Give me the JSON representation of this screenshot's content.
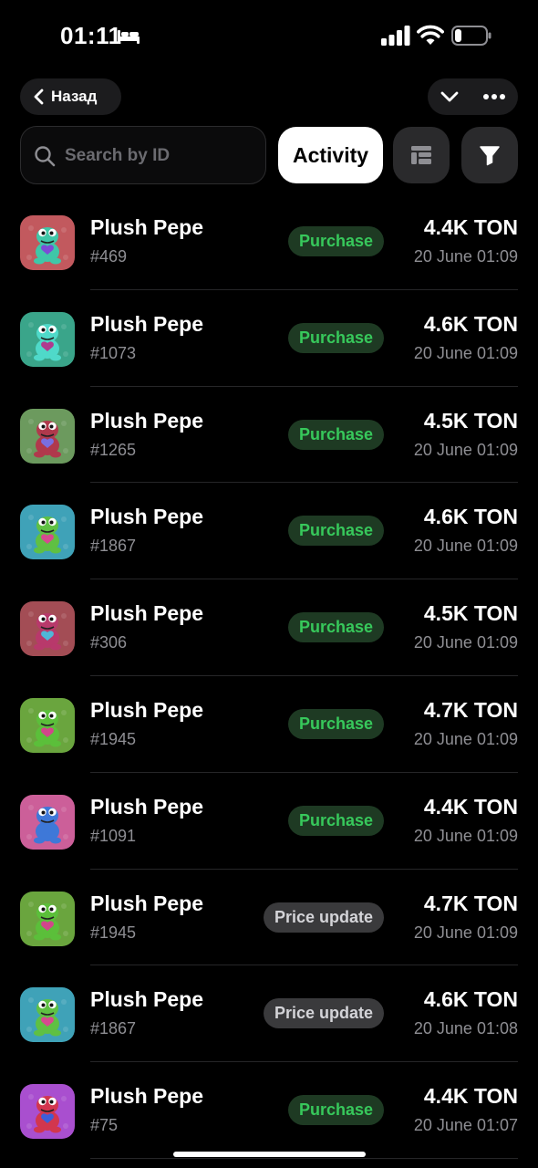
{
  "status": {
    "time": "01:11"
  },
  "nav": {
    "back_label": "Назад"
  },
  "search": {
    "placeholder": "Search by ID"
  },
  "tabs": {
    "active_label": "Activity"
  },
  "colors": {
    "purchase": "#37c85b",
    "background": "#000000"
  },
  "items": [
    {
      "name": "Plush Pepe",
      "id": "#469",
      "action": "Purchase",
      "price": "4.4K TON",
      "date": "20 June 01:09",
      "bg": "#c2595e",
      "frog": "#3fc7a8",
      "accent": "#7c4bd6"
    },
    {
      "name": "Plush Pepe",
      "id": "#1073",
      "action": "Purchase",
      "price": "4.6K TON",
      "date": "20 June 01:09",
      "bg": "#3aa58a",
      "frog": "#4fd9c9",
      "accent": "#b03a8e"
    },
    {
      "name": "Plush Pepe",
      "id": "#1265",
      "action": "Purchase",
      "price": "4.5K TON",
      "date": "20 June 01:09",
      "bg": "#6c9a5e",
      "frog": "#b0394c",
      "accent": "#7a6ee0"
    },
    {
      "name": "Plush Pepe",
      "id": "#1867",
      "action": "Purchase",
      "price": "4.6K TON",
      "date": "20 June 01:09",
      "bg": "#3fa2b8",
      "frog": "#5fc043",
      "accent": "#d64a8f"
    },
    {
      "name": "Plush Pepe",
      "id": "#306",
      "action": "Purchase",
      "price": "4.5K TON",
      "date": "20 June 01:09",
      "bg": "#a34d55",
      "frog": "#b8396b",
      "accent": "#4fb7d8"
    },
    {
      "name": "Plush Pepe",
      "id": "#1945",
      "action": "Purchase",
      "price": "4.7K TON",
      "date": "20 June 01:09",
      "bg": "#6aa53e",
      "frog": "#5bbf3a",
      "accent": "#d2468b"
    },
    {
      "name": "Plush Pepe",
      "id": "#1091",
      "action": "Purchase",
      "price": "4.4K TON",
      "date": "20 June 01:09",
      "bg": "#cc5f99",
      "frog": "#3e78d8",
      "accent": "#3e78d8"
    },
    {
      "name": "Plush Pepe",
      "id": "#1945",
      "action": "Price update",
      "price": "4.7K TON",
      "date": "20 June 01:09",
      "bg": "#6aa53e",
      "frog": "#5bbf3a",
      "accent": "#d2468b"
    },
    {
      "name": "Plush Pepe",
      "id": "#1867",
      "action": "Price update",
      "price": "4.6K TON",
      "date": "20 June 01:08",
      "bg": "#3fa2b8",
      "frog": "#5fc043",
      "accent": "#d64a8f"
    },
    {
      "name": "Plush Pepe",
      "id": "#75",
      "action": "Purchase",
      "price": "4.4K TON",
      "date": "20 June 01:07",
      "bg": "#a94fcf",
      "frog": "#d2364e",
      "accent": "#3c5ed8"
    }
  ]
}
